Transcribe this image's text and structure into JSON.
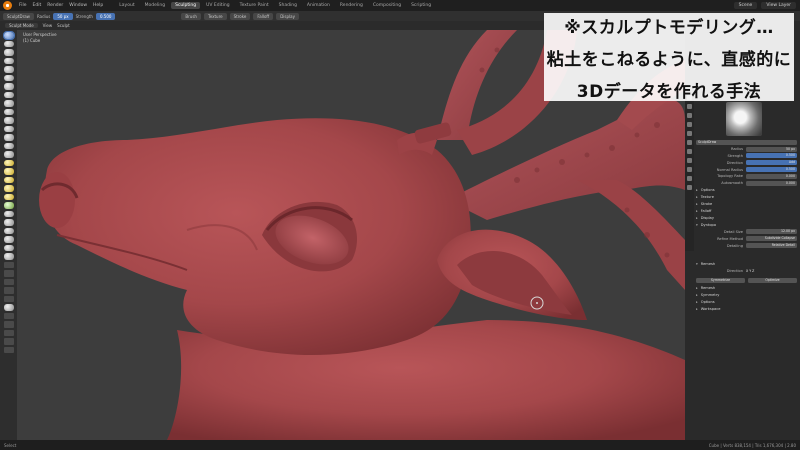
{
  "menubar": {
    "menus": [
      "File",
      "Edit",
      "Render",
      "Window",
      "Help"
    ],
    "workspaces": [
      "Layout",
      "Modeling",
      "Sculpting",
      "UV Editing",
      "Texture Paint",
      "Shading",
      "Animation",
      "Rendering",
      "Compositing",
      "Scripting"
    ],
    "active_workspace": "Sculpting",
    "scene": "Scene",
    "view_layer": "View Layer"
  },
  "toolbar": {
    "brush": "SculptDraw",
    "radius_label": "Radius",
    "radius_value": "50 px",
    "strength_label": "Strength",
    "strength_value": "0.500",
    "menus": [
      "Brush",
      "Texture",
      "Stroke",
      "Falloff",
      "Display"
    ]
  },
  "viewport": {
    "mode": "Sculpt Mode",
    "view_menu": "View",
    "sculpt_menu": "Sculpt",
    "overlay_line1": "User Perspective",
    "overlay_line2": "(1) Cube"
  },
  "properties": {
    "brush_name": "SculptDraw",
    "brush_section": "Brush",
    "rows": [
      {
        "label": "Radius",
        "value": "50 px"
      },
      {
        "label": "Strength",
        "value": "0.500"
      },
      {
        "label": "Direction",
        "value": "Add"
      },
      {
        "label": "Normal Radius",
        "value": "0.500"
      },
      {
        "label": "Topology Rake",
        "value": "0.000"
      },
      {
        "label": "Autosmooth",
        "value": "0.000"
      }
    ],
    "sections": [
      "Options",
      "Texture",
      "Stroke",
      "Falloff",
      "Display",
      "Dyntopo"
    ],
    "dyntopo_rows": [
      {
        "label": "Detail Size",
        "value": "12.00 px"
      },
      {
        "label": "Refine Method",
        "value": "Subdivide Collapse"
      },
      {
        "label": "Detailing",
        "value": "Relative Detail"
      }
    ],
    "remesh_section": "Remesh",
    "remesh_row": {
      "label": "Direction",
      "value": "X Y Z"
    },
    "remesh_buttons": [
      "Symmetrize",
      "Optimize"
    ],
    "bottom_sections": [
      "Remesh",
      "Symmetry",
      "Options",
      "Workspace"
    ]
  },
  "statusbar": {
    "left": "Select",
    "right": "Cube | Verts 838,154 | Tris 1,676,304 | 2.80"
  },
  "caption": {
    "line1": "※スカルプトモデリング…",
    "line2": "粘土をこねるように、直感的に",
    "line3": "3Dデータを作れる手法"
  },
  "colors": {
    "accent": "#4772b3",
    "model": "#a8474a",
    "viewport_bg": "#3d3d3d"
  }
}
